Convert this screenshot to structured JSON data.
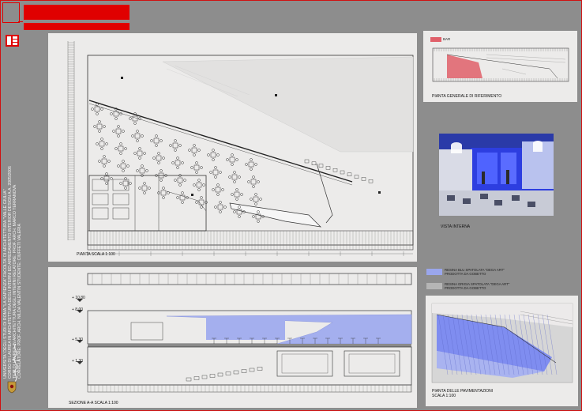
{
  "header": {
    "title": "",
    "accent_color": "#e00000"
  },
  "sidebar_text": {
    "lines": [
      "UNIVERSITA' DEGLI STUDI DI ROMA \"LA SAPIENZA\" FACOLTA' DI ARCHITETTURA \"VALLE GIULIA\"",
      "CORSO DI LAUREA IN ARCHITETTURA DEGLI INTERNI ED ARREDAMENTO INTERIOR DESIGN A.A. 2005/2006",
      "TESI DI LAUREA IN ARCHITETTURA DEGLI INTERNI  RELATORE: PROF. ARCH. MARCO TERRANOVA",
      "CORRELATORE: PROF. ARCH. NILDA VALENTIN    STUDENTE: CIUFFETI VALERIA",
      "TITOLO DI TESI: \"ALLESTIMENTO DI SPAZI POLIFUNZIONALI DEI MAGAZZINI DELL'EX INDUSTRIA ELETTROCHIMICA A PAVISINO (TERNI)\""
    ]
  },
  "plan": {
    "caption": "PIANTA SCALA 1:100"
  },
  "section": {
    "caption": "SEZIONE A-A SCALA 1:100",
    "levels": [
      "+ 10.80",
      "+ 8.00",
      "+ 5.30",
      "+ 1.30"
    ]
  },
  "reference": {
    "legend": "BAR",
    "caption": "PIANTA GENERALE DI RIFERIMENTO",
    "highlight_color": "#e0606a"
  },
  "render": {
    "caption": "VISTA INTERNA"
  },
  "floor_legend": {
    "item1_line1": "RESINA BLU SPATOLATA \"DEGA ART\"",
    "item1_line2": "PRODOTTA DA GOBETTO",
    "item1_color": "#9aa6ec",
    "item2_line1": "RESINA GRIGIA SPATOLATA \"DEGA ART\"",
    "item2_line2": "PRODOTTA DA GOBETTO",
    "item2_color": "#b5b5b5"
  },
  "floor_plan": {
    "caption_line1": "PIANTA DELLE PAVIMENTAZIONI",
    "caption_line2": "SCALA 1:100"
  }
}
